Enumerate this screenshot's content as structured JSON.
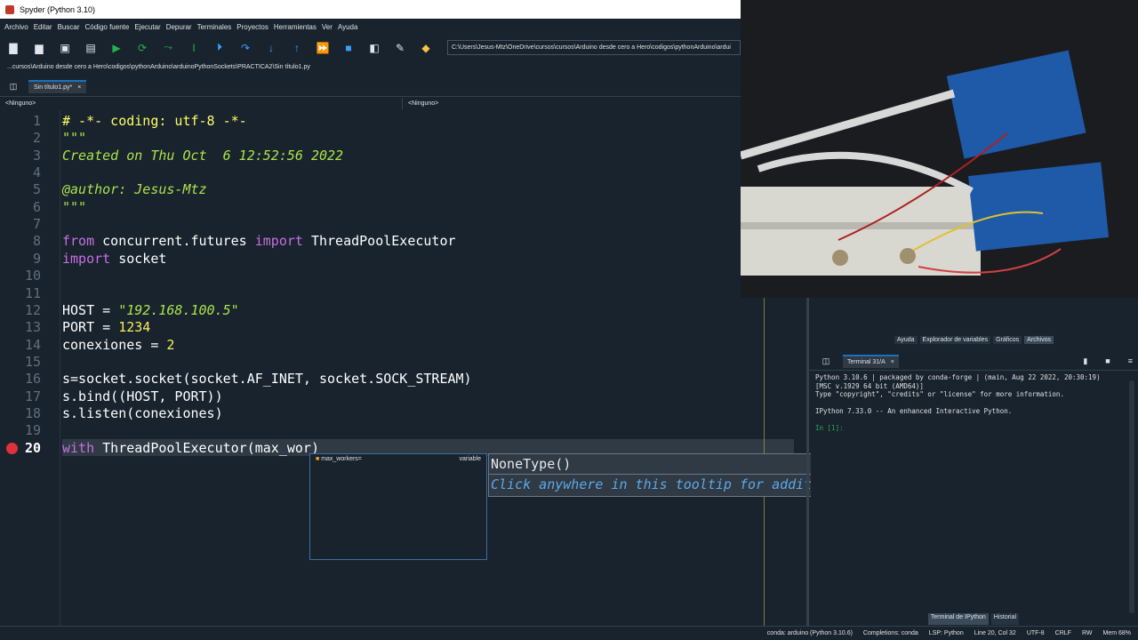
{
  "window": {
    "title": "Spyder (Python 3.10)"
  },
  "menu": [
    "Archivo",
    "Editar",
    "Buscar",
    "Código fuente",
    "Ejecutar",
    "Depurar",
    "Terminales",
    "Proyectos",
    "Herramientas",
    "Ver",
    "Ayuda"
  ],
  "toolbar": {
    "working_dir": "C:\\Users\\Jesus-Mtz\\OneDrive\\cursos\\cursos\\Arduino desde cero a Hero\\codigos\\pythonArduino\\ardui"
  },
  "breadcrumb": "...cursos\\Arduino desde cero a Hero\\codigos\\pythonArduino\\arduinoPythonSockets\\PRACTICA2\\Sin título1.py",
  "editor": {
    "tab_label": "Sin título1.py*",
    "tab_close": "×",
    "nav_left": "<Ninguno>",
    "nav_right": "<Ninguno>",
    "lines": [
      {
        "n": "1",
        "segments": [
          {
            "t": "# -*- coding: utf-8 -*-",
            "c": "#ffff66",
            "i": false
          }
        ]
      },
      {
        "n": "2",
        "segments": [
          {
            "t": "\"\"\"",
            "c": "#a9e34b",
            "i": true
          }
        ]
      },
      {
        "n": "3",
        "segments": [
          {
            "t": "Created on Thu Oct  6 12:52:56 2022",
            "c": "#a9e34b",
            "i": true
          }
        ]
      },
      {
        "n": "4",
        "segments": []
      },
      {
        "n": "5",
        "segments": [
          {
            "t": "@author: Jesus-Mtz",
            "c": "#a9e34b",
            "i": true
          }
        ]
      },
      {
        "n": "6",
        "segments": [
          {
            "t": "\"\"\"",
            "c": "#a9e34b",
            "i": true
          }
        ]
      },
      {
        "n": "7",
        "segments": []
      },
      {
        "n": "8",
        "segments": [
          {
            "t": "from",
            "c": "#c670e0",
            "i": false
          },
          {
            "t": " concurrent.futures ",
            "c": "#ffffff",
            "i": false
          },
          {
            "t": "import",
            "c": "#c670e0",
            "i": false
          },
          {
            "t": " ThreadPoolExecutor",
            "c": "#ffffff",
            "i": false
          }
        ]
      },
      {
        "n": "9",
        "segments": [
          {
            "t": "import",
            "c": "#c670e0",
            "i": false
          },
          {
            "t": " socket",
            "c": "#ffffff",
            "i": false
          }
        ]
      },
      {
        "n": "10",
        "segments": []
      },
      {
        "n": "11",
        "segments": []
      },
      {
        "n": "12",
        "segments": [
          {
            "t": "HOST = ",
            "c": "#ffffff",
            "i": false
          },
          {
            "t": "\"192.168.100.5\"",
            "c": "#a9e34b",
            "i": true
          }
        ]
      },
      {
        "n": "13",
        "segments": [
          {
            "t": "PORT = ",
            "c": "#ffffff",
            "i": false
          },
          {
            "t": "1234",
            "c": "#faed5c",
            "i": false
          }
        ]
      },
      {
        "n": "14",
        "segments": [
          {
            "t": "conexiones = ",
            "c": "#ffffff",
            "i": false
          },
          {
            "t": "2",
            "c": "#faed5c",
            "i": false
          }
        ]
      },
      {
        "n": "15",
        "segments": []
      },
      {
        "n": "16",
        "segments": [
          {
            "t": "s=socket.socket(socket.AF_INET, socket.SOCK_STREAM)",
            "c": "#ffffff",
            "i": false
          }
        ]
      },
      {
        "n": "17",
        "segments": [
          {
            "t": "s.bind((HOST, PORT))",
            "c": "#ffffff",
            "i": false
          }
        ]
      },
      {
        "n": "18",
        "segments": [
          {
            "t": "s.listen(conexiones)",
            "c": "#ffffff",
            "i": false
          }
        ]
      },
      {
        "n": "19",
        "segments": []
      },
      {
        "n": "20",
        "segments": [
          {
            "t": "with",
            "c": "#c670e0",
            "i": false
          },
          {
            "t": " ThreadPoolExecutor(max_wor)",
            "c": "#ffffff",
            "i": false
          }
        ]
      }
    ],
    "completion": {
      "name": "max_workers=",
      "kind": "variable"
    },
    "tooltip": {
      "signature": "NoneType()",
      "help": "Click anywhere in this tooltip for additional help"
    }
  },
  "right_panel": {
    "tabs": [
      "Ayuda",
      "Explorador de variables",
      "Gráficos",
      "Archivos"
    ],
    "console_tab": "Terminal 31/A",
    "console_lines": [
      "Python 3.10.6 | packaged by conda-forge | (main, Aug 22 2022, 20:30:19)",
      "[MSC v.1929 64 bit (AMD64)]",
      "Type \"copyright\", \"credits\" or \"license\" for more information.",
      "",
      "IPython 7.33.0 -- An enhanced Interactive Python.",
      "",
      "In [1]:"
    ],
    "bottom_tabs": [
      "Terminal de IPython",
      "Historial"
    ]
  },
  "statusbar": [
    "conda: arduino (Python 3.10.6)",
    "Completions: conda",
    "LSP: Python",
    "Line 20, Col 32",
    "UTF-8",
    "CRLF",
    "RW",
    "Mem 68%"
  ],
  "colors": {
    "bg": "#19232d",
    "accent": "#1a72bb"
  }
}
